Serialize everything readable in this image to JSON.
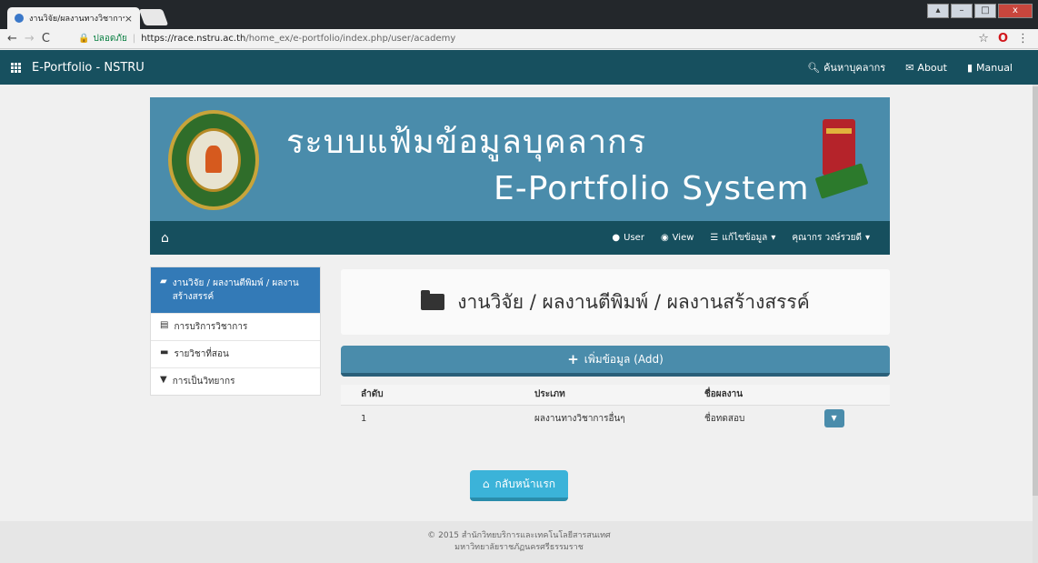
{
  "browser": {
    "tab_title": "งานวิจัย/ผลงานทางวิชาการ (",
    "tab_close": "×",
    "secure_label": "ปลอดภัย",
    "url_host": "https://race.nstru.ac.th",
    "url_path": "/home_ex/e-portfolio/index.php/user/academy",
    "star": "☆",
    "opera": "O",
    "menu": "⋮"
  },
  "navbar": {
    "brand": "E-Portfolio - NSTRU",
    "search_label": "ค้นหาบุคลากร",
    "about_label": "About",
    "manual_label": "Manual"
  },
  "banner": {
    "title_th": "ระบบแฟ้มข้อมูลบุคลากร",
    "title_en": "E-Portfolio System"
  },
  "subnav": {
    "user_label": "User",
    "view_label": "View",
    "edit_label": "แก้ไขข้อมูล",
    "person_label": "คุณากร วงษ์รวยดี"
  },
  "side_menu": {
    "items": [
      {
        "label": "งานวิจัย / ผลงานตีพิมพ์ / ผลงานสร้างสรรค์"
      },
      {
        "label": "การบริการวิชาการ"
      },
      {
        "label": "รายวิชาที่สอน"
      },
      {
        "label": "การเป็นวิทยากร"
      }
    ]
  },
  "main": {
    "page_title": "งานวิจัย / ผลงานตีพิมพ์ / ผลงานสร้างสรรค์",
    "add_button": "เพิ่มข้อมูล (Add)",
    "table": {
      "headers": [
        "ลำดับ",
        "ประเภท",
        "ชื่อผลงาน"
      ],
      "rows": [
        {
          "no": "1",
          "type": "ผลงานทางวิชาการอื่นๆ",
          "name": "ชื่อทดสอบ"
        }
      ]
    },
    "back_button": "กลับหน้าแรก"
  },
  "footer": {
    "line1": "© 2015 สำนักวิทยบริการและเทคโนโลยีสารสนเทศ",
    "line2": "มหาวิทยาลัยราชภัฏนครศรีธรรมราช"
  },
  "colors": {
    "navbar": "#17505f",
    "banner": "#4a8cab",
    "active_menu": "#337ab7",
    "back_button": "#3bb3d9"
  }
}
